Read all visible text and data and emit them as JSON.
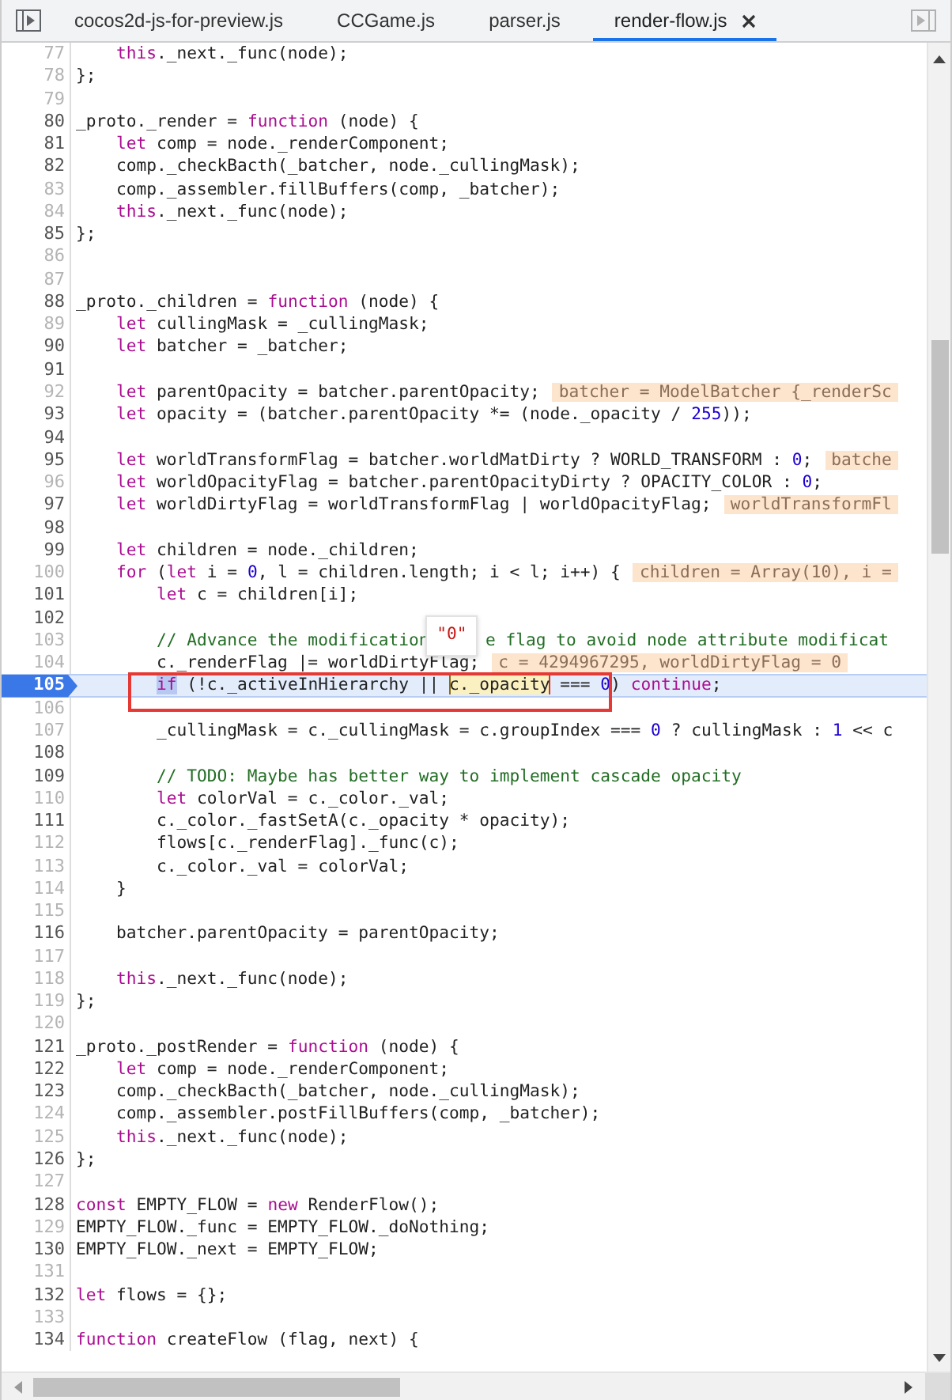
{
  "tabs": [
    {
      "label": "cocos2d-js-for-preview.js",
      "selected": false
    },
    {
      "label": "CCGame.js",
      "selected": false
    },
    {
      "label": "parser.js",
      "selected": false
    },
    {
      "label": "render-flow.js",
      "selected": true
    }
  ],
  "lines": [
    {
      "num": "77",
      "dim": true,
      "kind": "block",
      "parts": [
        {
          "kind": "code",
          "tokens": [
            {
              "kind": "kw",
              "text": "this"
            },
            {
              "kind": "p",
              "text": "._next._func(node);"
            }
          ]
        }
      ]
    },
    {
      "num": "78",
      "dim": true,
      "kind": "top",
      "parts": [
        {
          "kind": "code",
          "tokens": [
            {
              "kind": "p",
              "text": "};"
            }
          ]
        }
      ]
    },
    {
      "num": "79",
      "dim": true,
      "kind": "top"
    },
    {
      "num": "80",
      "dim": false,
      "kind": "top",
      "parts": [
        {
          "kind": "code",
          "tokens": [
            {
              "kind": "p",
              "text": "_proto._render = "
            },
            {
              "kind": "kw",
              "text": "function"
            },
            {
              "kind": "p",
              "text": " (node) {"
            }
          ]
        }
      ]
    },
    {
      "num": "81",
      "dim": false,
      "kind": "block",
      "parts": [
        {
          "kind": "code",
          "tokens": [
            {
              "kind": "kw",
              "text": "let"
            },
            {
              "kind": "p",
              "text": " comp = node._renderComponent;"
            }
          ]
        }
      ]
    },
    {
      "num": "82",
      "dim": false,
      "kind": "block",
      "parts": [
        {
          "kind": "code",
          "tokens": [
            {
              "kind": "p",
              "text": "comp._checkBacth(_batcher, node._cullingMask);"
            }
          ]
        }
      ]
    },
    {
      "num": "83",
      "dim": true,
      "kind": "block",
      "parts": [
        {
          "kind": "code",
          "tokens": [
            {
              "kind": "p",
              "text": "comp._assembler.fillBuffers(comp, _batcher);"
            }
          ]
        }
      ]
    },
    {
      "num": "84",
      "dim": true,
      "kind": "block",
      "parts": [
        {
          "kind": "code",
          "tokens": [
            {
              "kind": "kw",
              "text": "this"
            },
            {
              "kind": "p",
              "text": "._next._func(node);"
            }
          ]
        }
      ]
    },
    {
      "num": "85",
      "dim": false,
      "kind": "top",
      "parts": [
        {
          "kind": "code",
          "tokens": [
            {
              "kind": "p",
              "text": "};"
            }
          ]
        }
      ]
    },
    {
      "num": "86",
      "dim": true,
      "kind": "top"
    },
    {
      "num": "87",
      "dim": true,
      "kind": "top"
    },
    {
      "num": "88",
      "dim": false,
      "kind": "top",
      "parts": [
        {
          "kind": "code",
          "tokens": [
            {
              "kind": "p",
              "text": "_proto._children = "
            },
            {
              "kind": "kw",
              "text": "function"
            },
            {
              "kind": "p",
              "text": " (node) {"
            }
          ]
        }
      ]
    },
    {
      "num": "89",
      "dim": true,
      "kind": "block",
      "parts": [
        {
          "kind": "code",
          "tokens": [
            {
              "kind": "kw",
              "text": "let"
            },
            {
              "kind": "p",
              "text": " cullingMask = _cullingMask;"
            }
          ]
        }
      ]
    },
    {
      "num": "90",
      "dim": false,
      "kind": "block",
      "parts": [
        {
          "kind": "code",
          "tokens": [
            {
              "kind": "kw",
              "text": "let"
            },
            {
              "kind": "p",
              "text": " batcher = _batcher;"
            }
          ]
        }
      ]
    },
    {
      "num": "91",
      "dim": false,
      "kind": "top"
    },
    {
      "num": "92",
      "dim": true,
      "kind": "block",
      "parts": [
        {
          "kind": "code",
          "tokens": [
            {
              "kind": "kw",
              "text": "let"
            },
            {
              "kind": "p",
              "text": " parentOpacity = batcher.parentOpacity;"
            }
          ]
        },
        {
          "kind": "value",
          "text": "batcher = ModelBatcher {_renderSc"
        }
      ]
    },
    {
      "num": "93",
      "dim": false,
      "kind": "block",
      "parts": [
        {
          "kind": "code",
          "tokens": [
            {
              "kind": "kw",
              "text": "let"
            },
            {
              "kind": "p",
              "text": " opacity = (batcher.parentOpacity *= (node._opacity / "
            },
            {
              "kind": "num",
              "text": "255"
            },
            {
              "kind": "p",
              "text": "));"
            }
          ]
        }
      ]
    },
    {
      "num": "94",
      "dim": false,
      "kind": "top"
    },
    {
      "num": "95",
      "dim": false,
      "kind": "block",
      "parts": [
        {
          "kind": "code",
          "tokens": [
            {
              "kind": "kw",
              "text": "let"
            },
            {
              "kind": "p",
              "text": " worldTransformFlag = batcher.worldMatDirty ? WORLD_TRANSFORM : "
            },
            {
              "kind": "num",
              "text": "0"
            },
            {
              "kind": "p",
              "text": ";"
            }
          ]
        },
        {
          "kind": "value",
          "text": "batche"
        }
      ]
    },
    {
      "num": "96",
      "dim": true,
      "kind": "block",
      "parts": [
        {
          "kind": "code",
          "tokens": [
            {
              "kind": "kw",
              "text": "let"
            },
            {
              "kind": "p",
              "text": " worldOpacityFlag = batcher.parentOpacityDirty ? OPACITY_COLOR : "
            },
            {
              "kind": "num",
              "text": "0"
            },
            {
              "kind": "p",
              "text": ";"
            }
          ]
        }
      ]
    },
    {
      "num": "97",
      "dim": false,
      "kind": "block",
      "parts": [
        {
          "kind": "code",
          "tokens": [
            {
              "kind": "kw",
              "text": "let"
            },
            {
              "kind": "p",
              "text": " worldDirtyFlag = worldTransformFlag | worldOpacityFlag;"
            }
          ]
        },
        {
          "kind": "value",
          "text": "worldTransformFl"
        }
      ]
    },
    {
      "num": "98",
      "dim": false,
      "kind": "top"
    },
    {
      "num": "99",
      "dim": false,
      "kind": "block",
      "parts": [
        {
          "kind": "code",
          "tokens": [
            {
              "kind": "kw",
              "text": "let"
            },
            {
              "kind": "p",
              "text": " children = node._children;"
            }
          ]
        }
      ]
    },
    {
      "num": "100",
      "dim": true,
      "kind": "block",
      "parts": [
        {
          "kind": "code",
          "tokens": [
            {
              "kind": "kw",
              "text": "for"
            },
            {
              "kind": "p",
              "text": " ("
            },
            {
              "kind": "kw",
              "text": "let"
            },
            {
              "kind": "p",
              "text": " i = "
            },
            {
              "kind": "num",
              "text": "0"
            },
            {
              "kind": "p",
              "text": ", l = children.length; i < l; i++) {"
            }
          ]
        },
        {
          "kind": "value",
          "text": "children = Array(10), i ="
        }
      ]
    },
    {
      "num": "101",
      "dim": false,
      "kind": "inner",
      "parts": [
        {
          "kind": "code",
          "tokens": [
            {
              "kind": "kw",
              "text": "let"
            },
            {
              "kind": "p",
              "text": " c = children[i];"
            }
          ]
        }
      ]
    },
    {
      "num": "102",
      "dim": false,
      "kind": "top"
    },
    {
      "num": "103",
      "dim": true,
      "kind": "inner",
      "parts": [
        {
          "kind": "code",
          "tokens": [
            {
              "kind": "com",
              "text": "// Advance the modification"
            }
          ]
        },
        {
          "kind": "tooltip",
          "text": "\"0\""
        },
        {
          "kind": "code",
          "tokens": [
            {
              "kind": "com",
              "text": "e flag to avoid node attribute modificat"
            }
          ]
        }
      ]
    },
    {
      "num": "104",
      "dim": true,
      "kind": "inner",
      "parts": [
        {
          "kind": "code",
          "tokens": [
            {
              "kind": "p",
              "text": "c._renderFlag |= worldDirtyFlag;"
            }
          ]
        },
        {
          "kind": "value",
          "text": "c = 4294967295, worldDirtyFlag = 0"
        }
      ]
    },
    {
      "num": "105",
      "dim": false,
      "kind": "inner",
      "current": true,
      "boxed": true,
      "parts": [
        {
          "kind": "code",
          "tokens": [
            {
              "kind": "sel",
              "text": "if"
            },
            {
              "kind": "p",
              "text": " (!c._activeInHierarchy || "
            },
            {
              "kind": "hl",
              "text": "c._opacity"
            },
            {
              "kind": "p",
              "text": " === "
            },
            {
              "kind": "num",
              "text": "0"
            },
            {
              "kind": "p",
              "text": ") "
            },
            {
              "kind": "kw",
              "text": "continue"
            },
            {
              "kind": "p",
              "text": ";"
            }
          ]
        }
      ]
    },
    {
      "num": "106",
      "dim": true,
      "kind": "top"
    },
    {
      "num": "107",
      "dim": true,
      "kind": "inner",
      "parts": [
        {
          "kind": "code",
          "tokens": [
            {
              "kind": "p",
              "text": "_cullingMask = c._cullingMask = c.groupIndex === "
            },
            {
              "kind": "num",
              "text": "0"
            },
            {
              "kind": "p",
              "text": " ? cullingMask : "
            },
            {
              "kind": "num",
              "text": "1"
            },
            {
              "kind": "p",
              "text": " << c"
            }
          ]
        }
      ]
    },
    {
      "num": "108",
      "dim": false,
      "kind": "top"
    },
    {
      "num": "109",
      "dim": false,
      "kind": "inner",
      "parts": [
        {
          "kind": "code",
          "tokens": [
            {
              "kind": "com",
              "text": "// TODO: Maybe has better way to implement cascade opacity"
            }
          ]
        }
      ]
    },
    {
      "num": "110",
      "dim": true,
      "kind": "inner",
      "parts": [
        {
          "kind": "code",
          "tokens": [
            {
              "kind": "kw",
              "text": "let"
            },
            {
              "kind": "p",
              "text": " colorVal = c._color._val;"
            }
          ]
        }
      ]
    },
    {
      "num": "111",
      "dim": false,
      "kind": "inner",
      "parts": [
        {
          "kind": "code",
          "tokens": [
            {
              "kind": "p",
              "text": "c._color._fastSetA(c._opacity * opacity);"
            }
          ]
        }
      ]
    },
    {
      "num": "112",
      "dim": true,
      "kind": "inner",
      "parts": [
        {
          "kind": "code",
          "tokens": [
            {
              "kind": "p",
              "text": "flows[c._renderFlag]._func(c);"
            }
          ]
        }
      ]
    },
    {
      "num": "113",
      "dim": true,
      "kind": "inner",
      "parts": [
        {
          "kind": "code",
          "tokens": [
            {
              "kind": "p",
              "text": "c._color._val = colorVal;"
            }
          ]
        }
      ]
    },
    {
      "num": "114",
      "dim": true,
      "kind": "block",
      "parts": [
        {
          "kind": "code",
          "tokens": [
            {
              "kind": "p",
              "text": "}"
            }
          ]
        }
      ]
    },
    {
      "num": "115",
      "dim": true,
      "kind": "top"
    },
    {
      "num": "116",
      "dim": false,
      "kind": "block",
      "parts": [
        {
          "kind": "code",
          "tokens": [
            {
              "kind": "p",
              "text": "batcher.parentOpacity = parentOpacity;"
            }
          ]
        }
      ]
    },
    {
      "num": "117",
      "dim": true,
      "kind": "top"
    },
    {
      "num": "118",
      "dim": true,
      "kind": "block",
      "parts": [
        {
          "kind": "code",
          "tokens": [
            {
              "kind": "kw",
              "text": "this"
            },
            {
              "kind": "p",
              "text": "._next._func(node);"
            }
          ]
        }
      ]
    },
    {
      "num": "119",
      "dim": true,
      "kind": "top",
      "parts": [
        {
          "kind": "code",
          "tokens": [
            {
              "kind": "p",
              "text": "};"
            }
          ]
        }
      ]
    },
    {
      "num": "120",
      "dim": true,
      "kind": "top"
    },
    {
      "num": "121",
      "dim": false,
      "kind": "top",
      "parts": [
        {
          "kind": "code",
          "tokens": [
            {
              "kind": "p",
              "text": "_proto._postRender = "
            },
            {
              "kind": "kw",
              "text": "function"
            },
            {
              "kind": "p",
              "text": " (node) {"
            }
          ]
        }
      ]
    },
    {
      "num": "122",
      "dim": false,
      "kind": "block",
      "parts": [
        {
          "kind": "code",
          "tokens": [
            {
              "kind": "kw",
              "text": "let"
            },
            {
              "kind": "p",
              "text": " comp = node._renderComponent;"
            }
          ]
        }
      ]
    },
    {
      "num": "123",
      "dim": false,
      "kind": "block",
      "parts": [
        {
          "kind": "code",
          "tokens": [
            {
              "kind": "p",
              "text": "comp._checkBacth(_batcher, node._cullingMask);"
            }
          ]
        }
      ]
    },
    {
      "num": "124",
      "dim": true,
      "kind": "block",
      "parts": [
        {
          "kind": "code",
          "tokens": [
            {
              "kind": "p",
              "text": "comp._assembler.postFillBuffers(comp, _batcher);"
            }
          ]
        }
      ]
    },
    {
      "num": "125",
      "dim": true,
      "kind": "block",
      "parts": [
        {
          "kind": "code",
          "tokens": [
            {
              "kind": "kw",
              "text": "this"
            },
            {
              "kind": "p",
              "text": "._next._func(node);"
            }
          ]
        }
      ]
    },
    {
      "num": "126",
      "dim": false,
      "kind": "top",
      "parts": [
        {
          "kind": "code",
          "tokens": [
            {
              "kind": "p",
              "text": "};"
            }
          ]
        }
      ]
    },
    {
      "num": "127",
      "dim": true,
      "kind": "top"
    },
    {
      "num": "128",
      "dim": false,
      "kind": "top",
      "parts": [
        {
          "kind": "code",
          "tokens": [
            {
              "kind": "kw",
              "text": "const"
            },
            {
              "kind": "p",
              "text": " EMPTY_FLOW = "
            },
            {
              "kind": "kw",
              "text": "new"
            },
            {
              "kind": "p",
              "text": " RenderFlow();"
            }
          ]
        }
      ]
    },
    {
      "num": "129",
      "dim": true,
      "kind": "top",
      "parts": [
        {
          "kind": "code",
          "tokens": [
            {
              "kind": "p",
              "text": "EMPTY_FLOW._func = EMPTY_FLOW._doNothing;"
            }
          ]
        }
      ]
    },
    {
      "num": "130",
      "dim": false,
      "kind": "top",
      "parts": [
        {
          "kind": "code",
          "tokens": [
            {
              "kind": "p",
              "text": "EMPTY_FLOW._next = EMPTY_FLOW;"
            }
          ]
        }
      ]
    },
    {
      "num": "131",
      "dim": true,
      "kind": "top"
    },
    {
      "num": "132",
      "dim": false,
      "kind": "top",
      "parts": [
        {
          "kind": "code",
          "tokens": [
            {
              "kind": "kw",
              "text": "let"
            },
            {
              "kind": "p",
              "text": " flows = {};"
            }
          ]
        }
      ]
    },
    {
      "num": "133",
      "dim": true,
      "kind": "top"
    },
    {
      "num": "134",
      "dim": false,
      "kind": "top",
      "parts": [
        {
          "kind": "code",
          "tokens": [
            {
              "kind": "kw",
              "text": "function"
            },
            {
              "kind": "p",
              "text": " createFlow (flag, next) {"
            }
          ]
        }
      ]
    }
  ]
}
